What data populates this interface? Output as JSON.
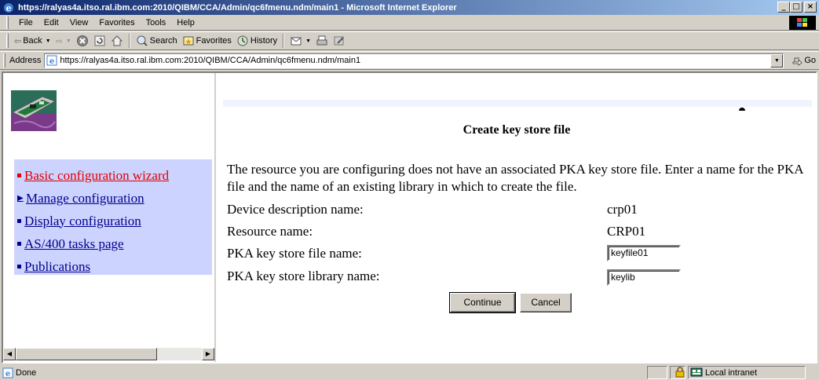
{
  "window": {
    "title": "https://ralyas4a.itso.ral.ibm.com:2010/QIBM/CCA/Admin/qc6fmenu.ndm/main1 - Microsoft Internet Explorer",
    "minimize": "_",
    "maximize": "□",
    "close": "×"
  },
  "menu": [
    "File",
    "Edit",
    "View",
    "Favorites",
    "Tools",
    "Help"
  ],
  "toolbar": {
    "back": "Back",
    "search": "Search",
    "favorites": "Favorites",
    "history": "History"
  },
  "address": {
    "label": "Address",
    "url": "https://ralyas4a.itso.ral.ibm.com:2010/QIBM/CCA/Admin/qc6fmenu.ndm/main1",
    "go": "Go"
  },
  "nav": {
    "items": [
      {
        "label": "Basic configuration wizard",
        "marker": "bullet",
        "active": true
      },
      {
        "label": "Manage configuration",
        "marker": "triangle",
        "active": false
      },
      {
        "label": "Display configuration",
        "marker": "bullet",
        "active": false
      },
      {
        "label": "AS/400 tasks page",
        "marker": "bullet",
        "active": false
      },
      {
        "label": "Publications",
        "marker": "bullet",
        "active": false
      }
    ]
  },
  "form": {
    "heading": "Create key store file",
    "description": "The resource you are configuring does not have an associated PKA key store file. Enter a name for the PKA file and the name of an existing library in which to create the file.",
    "device_label": "Device description name:",
    "device_value": "crp01",
    "resource_label": "Resource name:",
    "resource_value": "CRP01",
    "file_label": "PKA key store file name:",
    "file_value": "keyfile01",
    "library_label": "PKA key store library name:",
    "library_value": "keylib",
    "continue": "Continue",
    "cancel": "Cancel"
  },
  "status": {
    "text": "Done",
    "zone": "Local intranet"
  }
}
